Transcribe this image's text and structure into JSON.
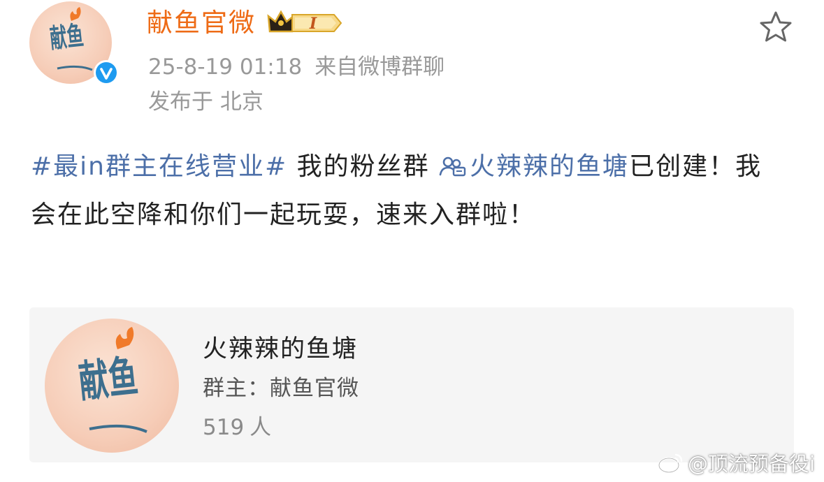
{
  "post": {
    "author_name": "献鱼官微",
    "vip_level": "I",
    "time": "25-8-19 01:18",
    "source": "来自微博群聊",
    "location": "发布于 北京",
    "topic": "#最in群主在线营业#",
    "text_before_link": " 我的粉丝群 ",
    "group_link": "火辣辣的鱼塘",
    "text_after_link": "已创建！我会在此空降和你们一起玩耍，速来入群啦！"
  },
  "group_card": {
    "name": "火辣辣的鱼塘",
    "owner": "群主：献鱼官微",
    "member_count": "519",
    "member_unit": "人"
  },
  "avatar_art": {
    "title": "献鱼"
  },
  "watermark": {
    "text": "@顶流预备役i"
  },
  "icons": {
    "favorite": "star-outline-icon",
    "verified": "verified-v-icon",
    "vip": "crown-vip-icon",
    "group": "group-chat-icon",
    "weibo": "weibo-logo-icon"
  },
  "colors": {
    "name": "#ee6b16",
    "link": "#4c6fa8",
    "meta": "#999999",
    "verified": "#1e9bf0",
    "card_bg": "#f5f5f5",
    "avatar_bg": "#f6cdb8"
  }
}
